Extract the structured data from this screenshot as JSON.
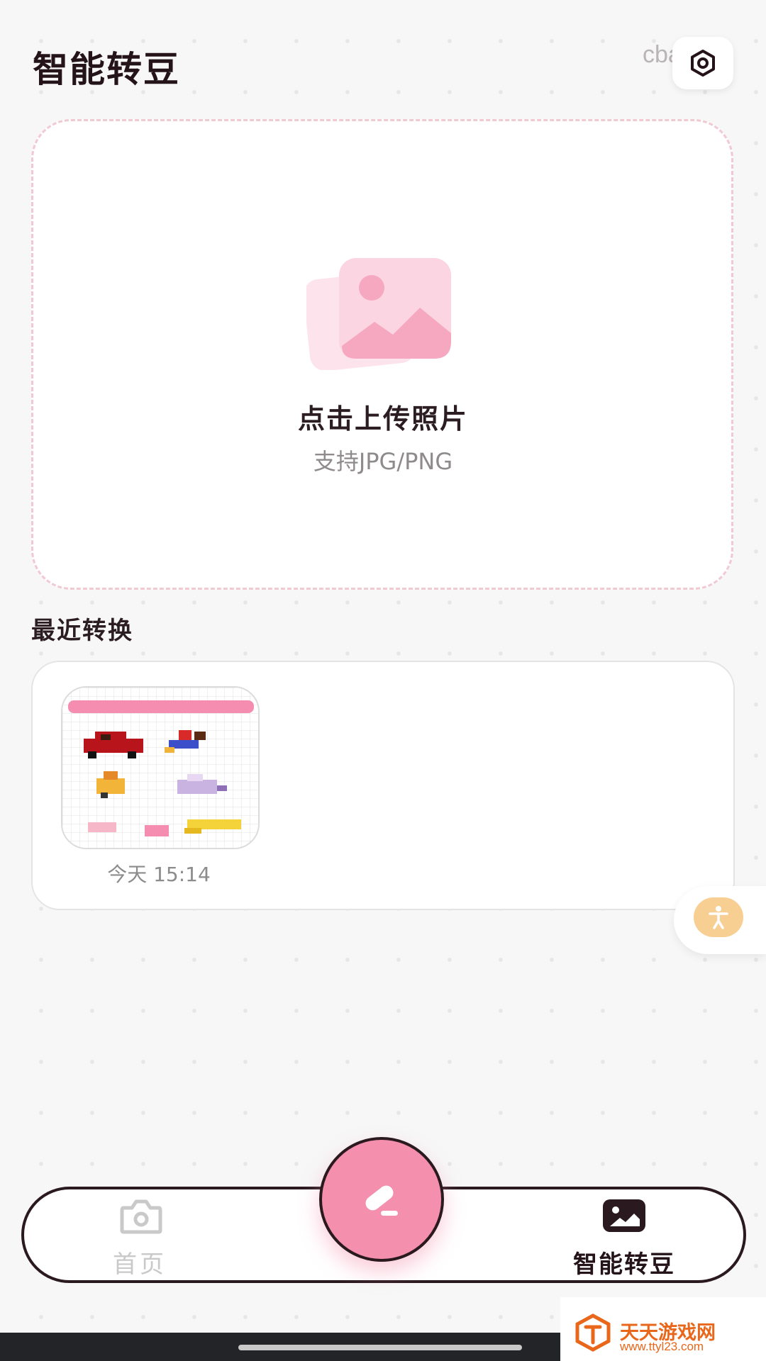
{
  "header": {
    "title": "智能转豆",
    "code_text": "cba06",
    "settings_icon": "settings-hexagon-icon"
  },
  "upload": {
    "title": "点击上传照片",
    "hint": "支持JPG/PNG",
    "illustration_icon": "photo-stack-icon",
    "accent_color": "#f48fae",
    "border_color": "#f1c9d3"
  },
  "recent": {
    "section_title": "最近转换",
    "items": [
      {
        "time": "今天 15:14",
        "thumbnail": "pixel-bead-pattern"
      }
    ]
  },
  "floating": {
    "icon": "accessibility-icon",
    "color": "#f8cf93"
  },
  "nav": {
    "home_label": "首页",
    "home_icon": "camera-icon",
    "convert_label": "智能转豆",
    "convert_icon": "image-icon",
    "fab_icon": "edit-icon",
    "fab_color": "#f48fae",
    "active_tab": "智能转豆"
  },
  "watermark": {
    "brand": "天天游戏网",
    "url": "www.ttyl23.com"
  }
}
